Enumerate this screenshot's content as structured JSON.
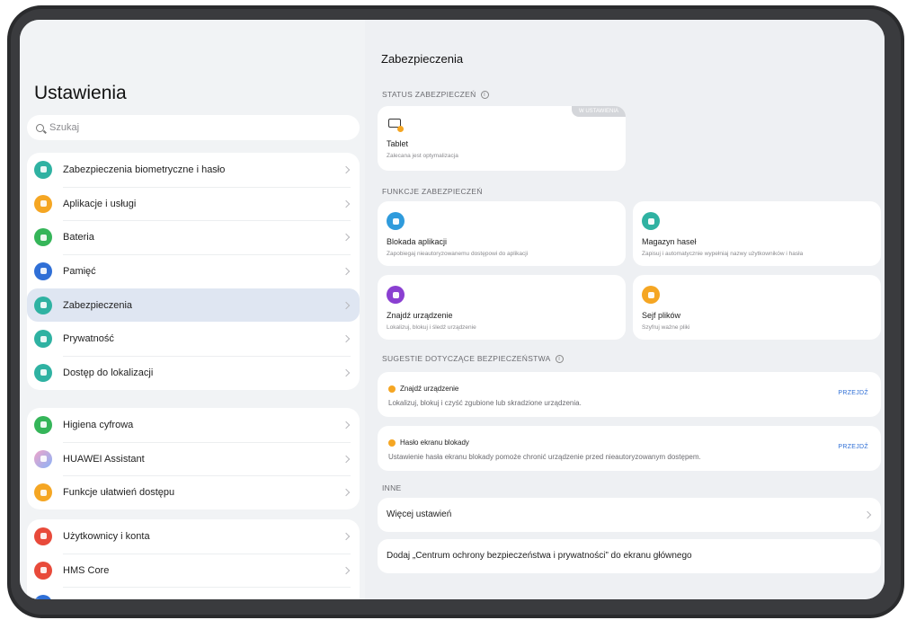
{
  "left": {
    "title": "Ustawienia",
    "search_placeholder": "Szukaj",
    "groups": [
      [
        {
          "label": "Zabezpieczenia biometryczne i hasło",
          "icon": "key-icon",
          "color": "#2fb2a2"
        },
        {
          "label": "Aplikacje i usługi",
          "icon": "apps-icon",
          "color": "#f5a623"
        },
        {
          "label": "Bateria",
          "icon": "battery-icon",
          "color": "#35b559"
        },
        {
          "label": "Pamięć",
          "icon": "storage-icon",
          "color": "#2f6fd6"
        },
        {
          "label": "Zabezpieczenia",
          "icon": "shield-icon",
          "color": "#2fb2a2",
          "selected": true
        },
        {
          "label": "Prywatność",
          "icon": "privacy-icon",
          "color": "#2fb2a2"
        },
        {
          "label": "Dostęp do lokalizacji",
          "icon": "location-icon",
          "color": "#2fb2a2"
        }
      ],
      [
        {
          "label": "Higiena cyfrowa",
          "icon": "hourglass-icon",
          "color": "#35b559"
        },
        {
          "label": "HUAWEI Assistant",
          "icon": "assistant-icon",
          "color": "#b58be8"
        },
        {
          "label": "Funkcje ułatwień dostępu",
          "icon": "accessibility-icon",
          "color": "#f5a623"
        }
      ],
      [
        {
          "label": "Użytkownicy i konta",
          "icon": "user-icon",
          "color": "#e84a3a"
        },
        {
          "label": "HMS Core",
          "icon": "hms-icon",
          "color": "#e84a3a"
        }
      ]
    ]
  },
  "right": {
    "title": "Zabezpieczenia",
    "status_section": "STATUS ZABEZPIECZEŃ",
    "status_card": {
      "title": "Tablet",
      "subtitle": "Zalecana jest optymalizacja",
      "badge": "W USTAWIENIA"
    },
    "features_section": "FUNKCJE ZABEZPIECZEŃ",
    "features": [
      {
        "title": "Blokada aplikacji",
        "subtitle": "Zapobiegaj nieautoryzowanemu dostępowi do aplikacji",
        "icon": "app-lock-icon",
        "color": "#2f9bdc"
      },
      {
        "title": "Magazyn haseł",
        "subtitle": "Zapisuj i automatycznie wypełniaj nazwy użytkowników i hasła",
        "icon": "password-vault-icon",
        "color": "#2fb2a2"
      },
      {
        "title": "Znajdź urządzenie",
        "subtitle": "Lokalizuj, blokuj i śledź urządzenie",
        "icon": "find-device-icon",
        "color": "#8a3fd1"
      },
      {
        "title": "Sejf plików",
        "subtitle": "Szyfruj ważne pliki",
        "icon": "file-safe-icon",
        "color": "#f5a623"
      }
    ],
    "suggestions_section": "SUGESTIE DOTYCZĄCE BEZPIECZEŃSTWA",
    "suggestions": [
      {
        "title": "Znajdź urządzenie",
        "desc": "Lokalizuj, blokuj i czyść zgubione lub skradzione urządzenia.",
        "button": "PRZEJDŹ"
      },
      {
        "title": "Hasło ekranu blokady",
        "desc": "Ustawienie hasła ekranu blokady pomoże chronić urządzenie przed nieautoryzowanym dostępem.",
        "button": "PRZEJDŹ"
      }
    ],
    "other_section": "INNE",
    "more_settings": "Więcej ustawień",
    "add_shortcut": "Dodaj „Centrum ochrony bezpieczeństwa i prywatności” do ekranu głównego"
  }
}
